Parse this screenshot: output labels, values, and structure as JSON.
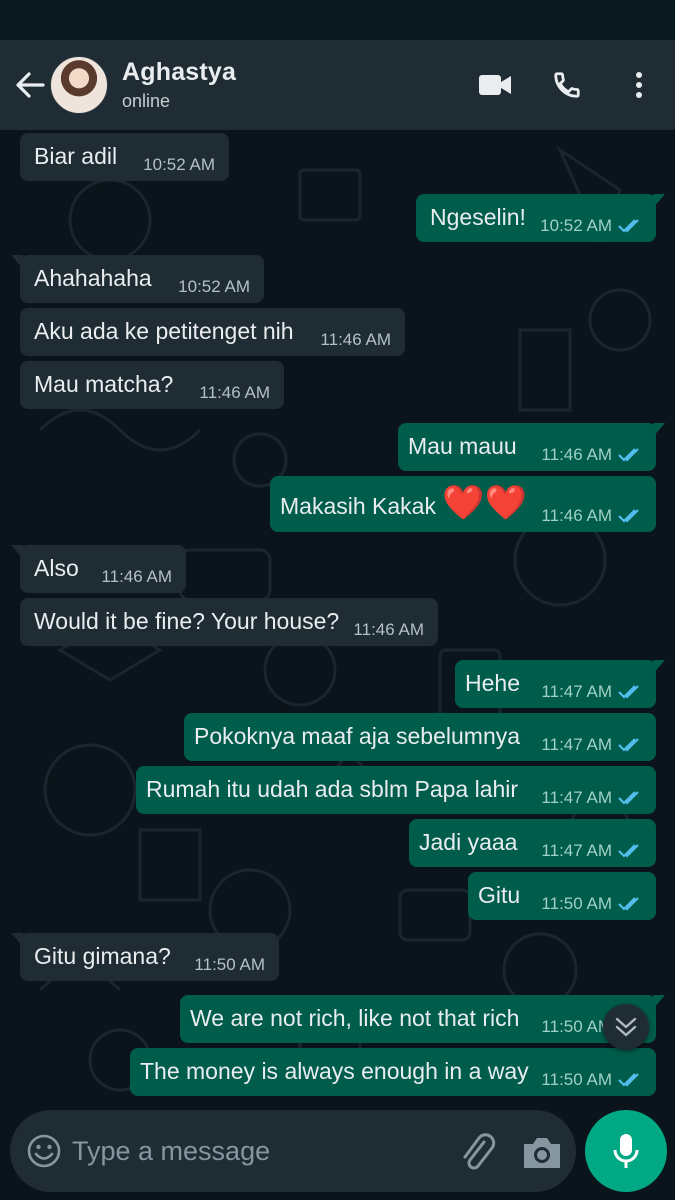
{
  "header": {
    "contact_name": "Aghastya",
    "contact_status": "online"
  },
  "messages": [
    {
      "dir": "in",
      "text": "Biar adil",
      "time": "10:52 AM"
    },
    {
      "dir": "out",
      "text": "Ngeselin!",
      "time": "10:52 AM",
      "status": "read"
    },
    {
      "dir": "in",
      "text": "Ahahahaha",
      "time": "10:52 AM"
    },
    {
      "dir": "in",
      "text": "Aku ada ke petitenget nih",
      "time": "11:46 AM"
    },
    {
      "dir": "in",
      "text": "Mau matcha?",
      "time": "11:46 AM"
    },
    {
      "dir": "out",
      "text": "Mau mauu",
      "time": "11:46 AM",
      "status": "read"
    },
    {
      "dir": "out",
      "text": "Makasih Kakak",
      "emoji": "❤️❤️",
      "time": "11:46 AM",
      "status": "read"
    },
    {
      "dir": "in",
      "text": "Also",
      "time": "11:46 AM"
    },
    {
      "dir": "in",
      "text": "Would it be fine? Your house?",
      "time": "11:46 AM"
    },
    {
      "dir": "out",
      "text": "Hehe",
      "time": "11:47 AM",
      "status": "read"
    },
    {
      "dir": "out",
      "text": "Pokoknya maaf aja sebelumnya",
      "time": "11:47 AM",
      "status": "read"
    },
    {
      "dir": "out",
      "text": "Rumah itu udah ada sblm Papa lahir",
      "time": "11:47 AM",
      "status": "read"
    },
    {
      "dir": "out",
      "text": "Jadi yaaa",
      "time": "11:47 AM",
      "status": "read"
    },
    {
      "dir": "out",
      "text": "Gitu",
      "time": "11:50 AM",
      "status": "read"
    },
    {
      "dir": "in",
      "text": "Gitu gimana?",
      "time": "11:50 AM"
    },
    {
      "dir": "out",
      "text": "We are not rich, like not that rich",
      "time": "11:50 AM",
      "status": "read"
    },
    {
      "dir": "out",
      "text": "The money is always enough in a way",
      "time": "11:50 AM",
      "status": "read"
    }
  ],
  "composer": {
    "placeholder": "Type a message"
  },
  "colors": {
    "header_bg": "#1f2c34",
    "chat_bg": "#0b141a",
    "incoming_bubble": "#1f2c34",
    "outgoing_bubble": "#005c4b",
    "read_ticks": "#53bdeb",
    "accent": "#00a884"
  },
  "icons": [
    "back-arrow-icon",
    "video-call-icon",
    "voice-call-icon",
    "more-options-icon",
    "emoji-icon",
    "attach-icon",
    "camera-icon",
    "mic-icon",
    "chevron-down-icon",
    "double-check-icon"
  ]
}
